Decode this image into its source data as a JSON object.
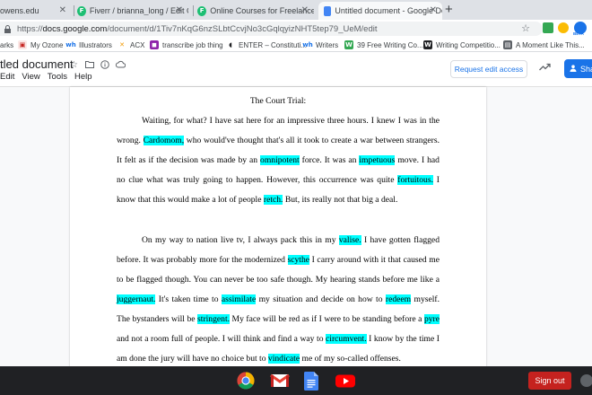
{
  "browser": {
    "tabs": [
      {
        "label": "owens.edu",
        "active": false
      },
      {
        "label": "Fiverr / brianna_long / Edit Gig",
        "active": false
      },
      {
        "label": "Online Courses for Freelancers",
        "active": false
      },
      {
        "label": "Untitled document - Google Doc",
        "active": true
      }
    ],
    "fav_letter": "F",
    "url_scheme": "https://",
    "url_host": "docs.google.com",
    "url_path": "/document/d/1Tiv7nKqG6nzSLbtCcvjNo3cGqlqyizNHT5tep79_UeM/edit",
    "bookmarks": [
      {
        "label": "arks",
        "icon": ""
      },
      {
        "label": "My Ozone",
        "icon": "ozone-icon"
      },
      {
        "label": "Illustrators",
        "icon": "wh-icon",
        "prefix": "wh"
      },
      {
        "label": "ACX",
        "icon": "acx-icon"
      },
      {
        "label": "transcribe job thing",
        "icon": "transcribe-icon"
      },
      {
        "label": "ENTER – Constituti...",
        "icon": "enter-icon"
      },
      {
        "label": "Writers",
        "icon": "wh-icon",
        "prefix": "wh"
      },
      {
        "label": "39 Free Writing Co...",
        "icon": "w-icon",
        "prefix": "W"
      },
      {
        "label": "Writing Competitio...",
        "icon": "w-icon",
        "prefix": "W"
      },
      {
        "label": "A Moment Like This...",
        "icon": "moment-icon"
      }
    ],
    "ext_badge": "BETA"
  },
  "docs": {
    "title": "tled document",
    "menu": [
      "Edit",
      "View",
      "Tools",
      "Help"
    ],
    "request_edit_label": "Request edit access",
    "share_label": "Sha"
  },
  "document": {
    "title_line": "The Court Trial:",
    "p1": [
      {
        "t": "Waiting, for what? I have sat here for an impressive three hours. I knew I was in the wrong. "
      },
      {
        "t": "Cardomom,",
        "hl": true
      },
      {
        "t": " who would've thought that's all it took to create a war between strangers. It felt as if the decision was made by an "
      },
      {
        "t": "omnipotent",
        "hl": true
      },
      {
        "t": " force. It was an "
      },
      {
        "t": "impetuous",
        "hl": true
      },
      {
        "t": " move. I had no clue what was truly going to happen. However, this occurrence was quite "
      },
      {
        "t": "fortuitous.",
        "hl": true
      },
      {
        "t": " I know that this would make a lot of people "
      },
      {
        "t": "retch.",
        "hl": true
      },
      {
        "t": " But, its really not that big a deal."
      }
    ],
    "p2": [
      {
        "t": "On my way to nation live tv, I always pack this in my "
      },
      {
        "t": "valise.",
        "hl": true
      },
      {
        "t": " I have gotten flagged before. It was probably more for the modernized "
      },
      {
        "t": "scythe",
        "hl": true
      },
      {
        "t": " I carry around with it that caused me to be flagged though. You can never be too safe though. My hearing stands before me like a "
      },
      {
        "t": "juggernaut.",
        "hl": true
      },
      {
        "t": " It's taken time to "
      },
      {
        "t": "assimilate",
        "hl": true
      },
      {
        "t": " my situation and decide on how to "
      },
      {
        "t": "redeem",
        "hl": true
      },
      {
        "t": " myself. The bystanders will be "
      },
      {
        "t": "stringent.",
        "hl": true
      },
      {
        "t": " My face will be red as if I were to be standing before a "
      },
      {
        "t": "pyre",
        "hl": true
      },
      {
        "t": " and not a room full of people. I will think and find a way to "
      },
      {
        "t": "circumvent.",
        "hl": true
      },
      {
        "t": " I know by the time I am done the jury will have no choice but to "
      },
      {
        "t": "vindicate",
        "hl": true
      },
      {
        "t": " me of my so-called offenses."
      }
    ]
  },
  "taskbar": {
    "apps": [
      "chrome-icon",
      "gmail-icon",
      "docs-icon",
      "youtube-icon"
    ],
    "signout_label": "Sign out"
  }
}
